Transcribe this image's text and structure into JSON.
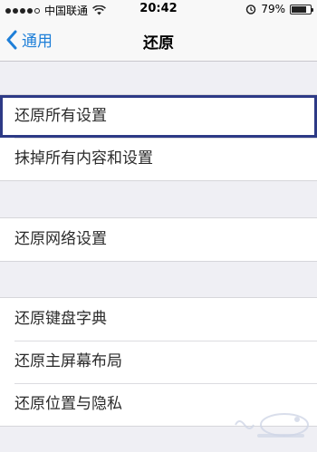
{
  "status_bar": {
    "carrier": "中国联通",
    "time": "20:42",
    "battery": "79%",
    "battery_level": 0.79,
    "icons": [
      "signal-dots",
      "wifi-icon",
      "alarm-icon",
      "battery-icon"
    ]
  },
  "nav": {
    "back_label": "通用",
    "title": "还原"
  },
  "groups": [
    {
      "items": [
        {
          "label": "还原所有设置",
          "selected": true
        },
        {
          "label": "抹掉所有内容和设置"
        }
      ]
    },
    {
      "items": [
        {
          "label": "还原网络设置"
        }
      ]
    },
    {
      "items": [
        {
          "label": "还原键盘字典"
        },
        {
          "label": "还原主屏幕布局"
        },
        {
          "label": "还原位置与隐私"
        }
      ]
    }
  ],
  "colors": {
    "accent": "#1e7fd8",
    "background": "#efeff4",
    "cell": "#ffffff",
    "selection_border": "#2d3a86"
  }
}
